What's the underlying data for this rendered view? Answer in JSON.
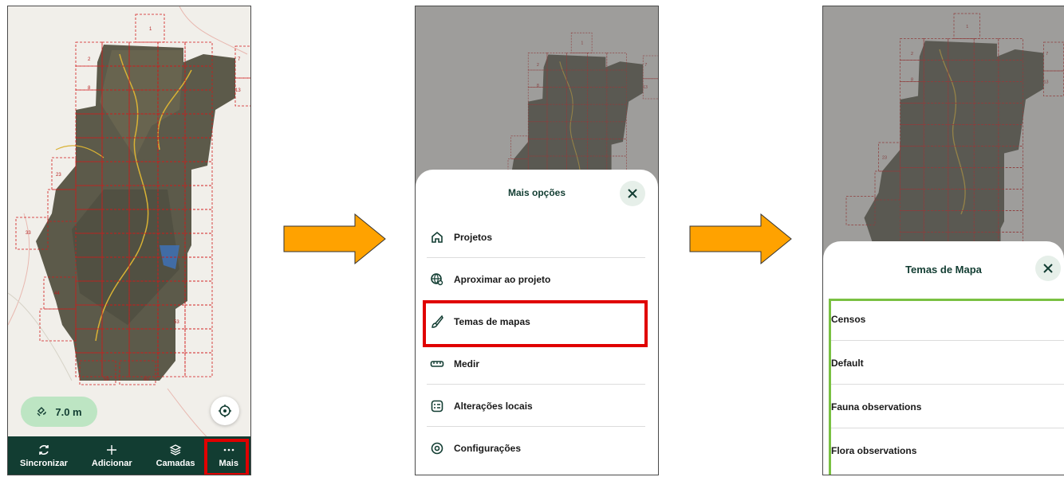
{
  "screen1": {
    "gps_accuracy": "7.0 m",
    "nav": [
      {
        "label": "Sincronizar",
        "icon": "sync-icon"
      },
      {
        "label": "Adicionar",
        "icon": "plus-icon"
      },
      {
        "label": "Camadas",
        "icon": "layers-icon"
      },
      {
        "label": "Mais",
        "icon": "more-icon"
      }
    ]
  },
  "screen2": {
    "title": "Mais opções",
    "items": [
      {
        "label": "Projetos",
        "icon": "home-icon"
      },
      {
        "label": "Aproximar ao projeto",
        "icon": "globe-search-icon"
      },
      {
        "label": "Temas de mapas",
        "icon": "brush-icon"
      },
      {
        "label": "Medir",
        "icon": "ruler-icon"
      },
      {
        "label": "Alterações locais",
        "icon": "local-changes-icon"
      },
      {
        "label": "Configurações",
        "icon": "settings-icon"
      }
    ]
  },
  "screen3": {
    "title": "Temas de Mapa",
    "themes": [
      "Censos",
      "Default",
      "Fauna observations",
      "Flora observations"
    ]
  },
  "grid_labels_full": [
    "1",
    "2",
    "7",
    "8",
    "13",
    "23",
    "33",
    "44",
    "53",
    "59",
    "60"
  ],
  "grid_labels_small": [
    "1",
    "2",
    "7",
    "8",
    "13",
    "23"
  ],
  "colors": {
    "dark_green": "#123d32",
    "highlight_red": "#e00000",
    "highlight_green": "#7ac142",
    "arrow": "#ffa200"
  }
}
